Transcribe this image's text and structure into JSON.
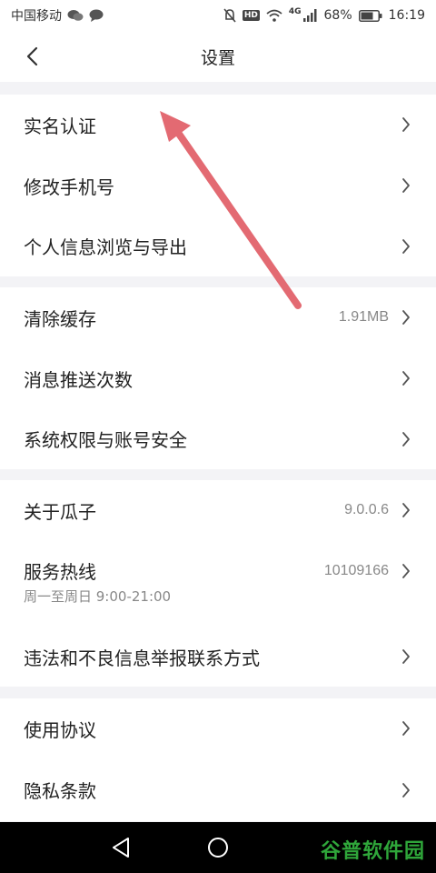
{
  "status_bar": {
    "carrier": "中国移动",
    "network": "4G",
    "battery": "68%",
    "time": "16:19",
    "hd_badge": "HD"
  },
  "header": {
    "title": "设置"
  },
  "groups": [
    {
      "items": [
        {
          "label": "实名认证",
          "value": ""
        },
        {
          "label": "修改手机号",
          "value": ""
        },
        {
          "label": "个人信息浏览与导出",
          "value": ""
        }
      ]
    },
    {
      "items": [
        {
          "label": "清除缓存",
          "value": "1.91MB"
        },
        {
          "label": "消息推送次数",
          "value": ""
        },
        {
          "label": "系统权限与账号安全",
          "value": ""
        }
      ]
    },
    {
      "items": [
        {
          "label": "关于瓜子",
          "value": "9.0.0.6"
        },
        {
          "label": "服务热线",
          "value": "10109166",
          "sub": "周一至周日 9:00-21:00"
        },
        {
          "label": "违法和不良信息举报联系方式",
          "value": ""
        }
      ]
    },
    {
      "items": [
        {
          "label": "使用协议",
          "value": ""
        },
        {
          "label": "隐私条款",
          "value": ""
        }
      ]
    }
  ],
  "watermark": "谷普软件园",
  "colors": {
    "accent_arrow": "#e36a72",
    "background": "#f3f3f6",
    "watermark": "#2fa63a"
  }
}
